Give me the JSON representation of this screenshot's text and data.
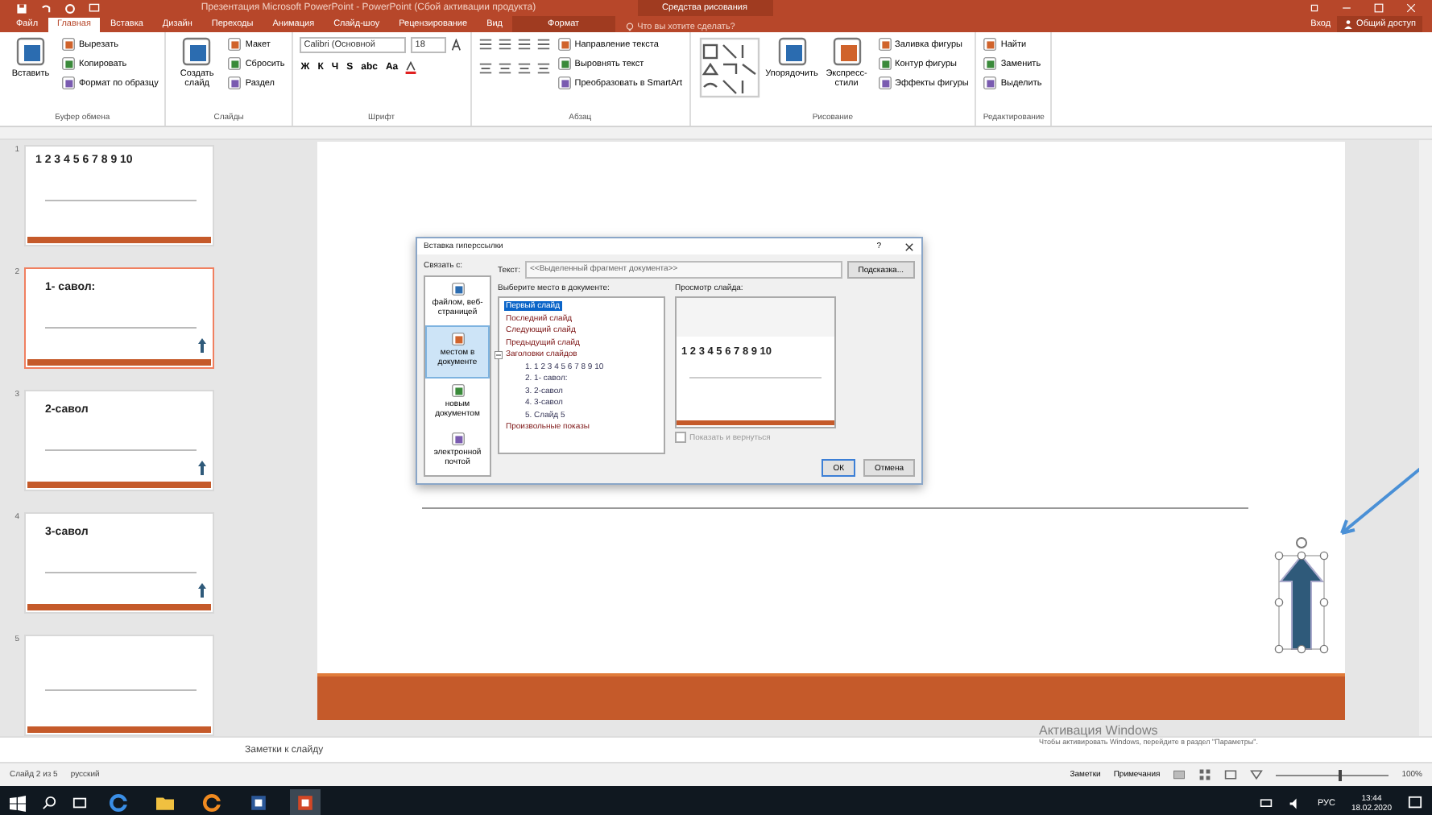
{
  "title_bar": {
    "title": "Презентация Microsoft PowerPoint - PowerPoint (Сбой активации продукта)",
    "context": "Средства рисования"
  },
  "tabs": [
    {
      "label": "Файл",
      "selected": false,
      "kind": "file"
    },
    {
      "label": "Главная",
      "selected": true,
      "kind": "normal"
    },
    {
      "label": "Вставка",
      "selected": false,
      "kind": "normal"
    },
    {
      "label": "Дизайн",
      "selected": false,
      "kind": "normal"
    },
    {
      "label": "Переходы",
      "selected": false,
      "kind": "normal"
    },
    {
      "label": "Анимация",
      "selected": false,
      "kind": "normal"
    },
    {
      "label": "Слайд-шоу",
      "selected": false,
      "kind": "normal"
    },
    {
      "label": "Рецензирование",
      "selected": false,
      "kind": "normal"
    },
    {
      "label": "Вид",
      "selected": false,
      "kind": "normal"
    },
    {
      "label": "Формат",
      "selected": false,
      "kind": "contextual"
    }
  ],
  "tell_me": "Что вы хотите сделать?",
  "sign_in": "Вход",
  "share": "Общий доступ",
  "ribbon_groups": [
    {
      "kind": "commands",
      "label": "Буфер обмена",
      "commands": [
        {
          "label": "Вставить",
          "kind": "large"
        },
        {
          "label": "Вырезать",
          "kind": "small"
        },
        {
          "label": "Копировать",
          "kind": "small"
        },
        {
          "label": "Формат по образцу",
          "kind": "small"
        }
      ]
    },
    {
      "kind": "commands",
      "label": "Слайды",
      "commands": [
        {
          "label": "Создать слайд",
          "kind": "large"
        },
        {
          "label": "Макет",
          "kind": "small"
        },
        {
          "label": "Сбросить",
          "kind": "small"
        },
        {
          "label": "Раздел",
          "kind": "small"
        }
      ]
    },
    {
      "kind": "font",
      "label": "Шрифт",
      "font_name": "Calibri (Основной",
      "font_size": "18",
      "format_buttons": [
        "Ж",
        "К",
        "Ч",
        "S",
        "abc",
        "Aa"
      ]
    },
    {
      "kind": "paragraph",
      "label": "Абзац",
      "commands": [
        {
          "label": "Направление текста",
          "kind": "small"
        },
        {
          "label": "Выровнять текст",
          "kind": "small"
        },
        {
          "label": "Преобразовать в SmartArt",
          "kind": "small"
        }
      ]
    },
    {
      "kind": "drawing",
      "label": "Рисование",
      "commands": [
        {
          "label": "Упорядочить",
          "kind": "large"
        },
        {
          "label": "Экспресс-стили",
          "kind": "large"
        },
        {
          "label": "Заливка фигуры",
          "kind": "small"
        },
        {
          "label": "Контур фигуры",
          "kind": "small"
        },
        {
          "label": "Эффекты фигуры",
          "kind": "small"
        }
      ]
    },
    {
      "kind": "commands",
      "label": "Редактирование",
      "commands": [
        {
          "label": "Найти",
          "kind": "small"
        },
        {
          "label": "Заменить",
          "kind": "small"
        },
        {
          "label": "Выделить",
          "kind": "small"
        }
      ]
    }
  ],
  "slides": [
    {
      "number": "1",
      "title": "1 2 3 4 5 6 7 8 9 10",
      "kind": "numbers",
      "selected": false,
      "arrow": false
    },
    {
      "number": "2",
      "title": "1- савол:",
      "kind": "question",
      "selected": true,
      "arrow": true
    },
    {
      "number": "3",
      "title": "2-савол",
      "kind": "question",
      "selected": false,
      "arrow": true
    },
    {
      "number": "4",
      "title": "3-савол",
      "kind": "question",
      "selected": false,
      "arrow": true
    },
    {
      "number": "5",
      "kind": "blank",
      "selected": false,
      "arrow": false
    }
  ],
  "dialog": {
    "title": "Вставка гиперссылки",
    "help": "?",
    "link_to": "Связать с:",
    "link_options": [
      {
        "label": "файлом, веб-страницей",
        "selected": false
      },
      {
        "label": "местом в документе",
        "selected": true
      },
      {
        "label": "новым документом",
        "selected": false
      },
      {
        "label": "электронной почтой",
        "selected": false
      }
    ],
    "text_label": "Текст:",
    "text_value": "<<Выделенный фрагмент документа>>",
    "tip_button": "Подсказка...",
    "place_label": "Выберите место в документе:",
    "places": [
      {
        "label": "Первый слайд",
        "selected": true
      },
      {
        "label": "Последний слайд",
        "selected": false
      },
      {
        "label": "Следующий слайд",
        "selected": false
      },
      {
        "label": "Предыдущий слайд",
        "selected": false
      },
      {
        "label": "Заголовки слайдов",
        "selected": false,
        "expanded": true,
        "children": [
          {
            "label": "1. 1 2 3 4 5 6 7 8 9 10",
            "selected": false
          },
          {
            "label": "2. 1- савол:",
            "selected": false
          },
          {
            "label": "3. 2-савол",
            "selected": false
          },
          {
            "label": "4. 3-савол",
            "selected": false
          },
          {
            "label": "5. Слайд 5",
            "selected": false
          }
        ]
      },
      {
        "label": "Произвольные показы",
        "selected": false
      }
    ],
    "preview_label": "Просмотр слайда:",
    "preview_title": "1 2 3 4 5 6 7 8 9 10",
    "show_and_return": {
      "label": "Показать и вернуться",
      "checked": false
    },
    "ok": "ОК",
    "cancel": "Отмена"
  },
  "notes_placeholder": "Заметки к слайду",
  "activation": {
    "title": "Активация Windows",
    "text": "Чтобы активировать Windows, перейдите в раздел \"Параметры\"."
  },
  "status_bar": {
    "slide": "Слайд 2 из 5",
    "language": "русский",
    "notes": "Заметки",
    "comments": "Примечания",
    "zoom": {
      "level": 0.55,
      "reading": "100%"
    }
  },
  "taskbar": {
    "apps": [
      {
        "kind": "edge",
        "selected": false
      },
      {
        "kind": "explorer",
        "selected": false
      },
      {
        "kind": "browser",
        "selected": false
      },
      {
        "kind": "word",
        "selected": false
      },
      {
        "kind": "powerpoint",
        "selected": true
      }
    ],
    "language": "РУС",
    "time": "13:44",
    "date": "18.02.2020"
  }
}
